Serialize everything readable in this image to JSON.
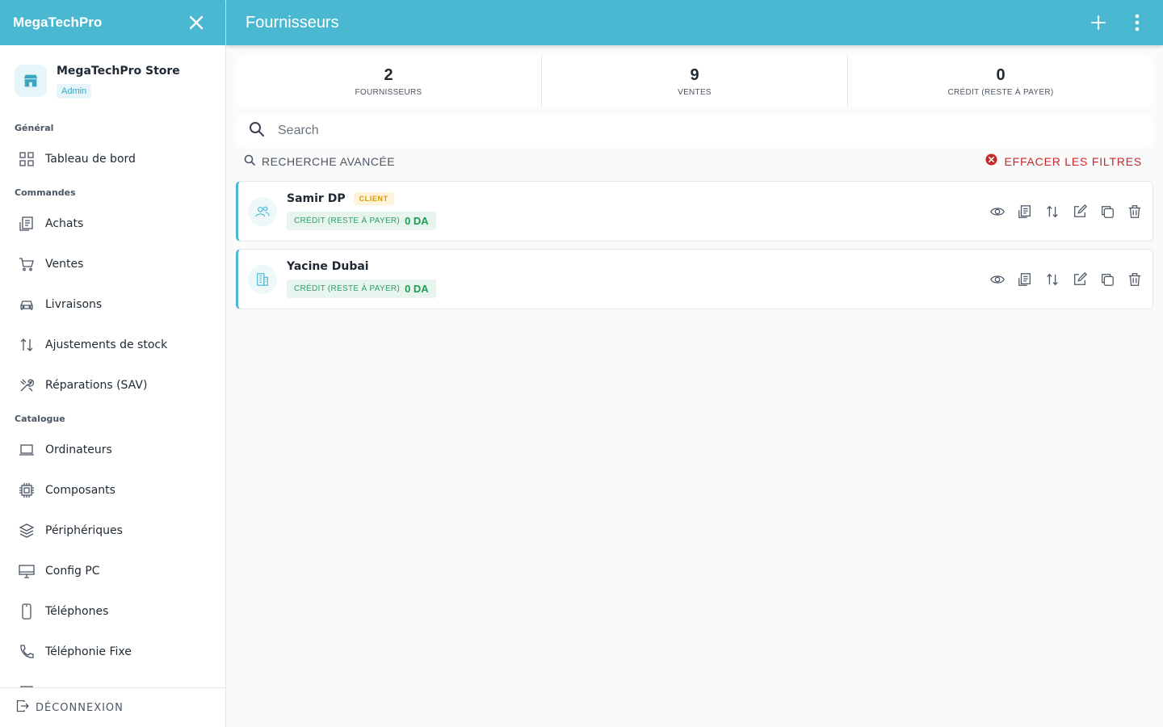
{
  "sidebar": {
    "brand": "MegaTechPro",
    "store": {
      "name": "MegaTechPro Store",
      "role": "Admin"
    },
    "sections": [
      {
        "title": "Général",
        "items": [
          {
            "label": "Tableau de bord",
            "icon": "dashboard-icon"
          }
        ]
      },
      {
        "title": "Commandes",
        "items": [
          {
            "label": "Achats",
            "icon": "purchase-icon"
          },
          {
            "label": "Ventes",
            "icon": "cart-icon"
          },
          {
            "label": "Livraisons",
            "icon": "car-icon"
          },
          {
            "label": "Ajustements de stock",
            "icon": "swap-icon"
          },
          {
            "label": "Réparations (SAV)",
            "icon": "tools-icon"
          }
        ]
      },
      {
        "title": "Catalogue",
        "items": [
          {
            "label": "Ordinateurs",
            "icon": "laptop-icon"
          },
          {
            "label": "Composants",
            "icon": "chip-icon"
          },
          {
            "label": "Périphériques",
            "icon": "layers-icon"
          },
          {
            "label": "Config PC",
            "icon": "monitor-icon"
          },
          {
            "label": "Téléphones",
            "icon": "phone-icon"
          },
          {
            "label": "Téléphonie Fixe",
            "icon": "landline-icon"
          }
        ]
      }
    ],
    "logout": "DÉCONNEXION"
  },
  "header": {
    "title": "Fournisseurs"
  },
  "stats": [
    {
      "value": "2",
      "label": "FOURNISSEURS"
    },
    {
      "value": "9",
      "label": "VENTES"
    },
    {
      "value": "0",
      "label": "CRÉDIT (RESTE À PAYER)"
    }
  ],
  "search": {
    "placeholder": "Search",
    "value": ""
  },
  "filters": {
    "advanced": "RECHERCHE AVANCÉE",
    "clear": "EFFACER LES FILTRES"
  },
  "suppliers": [
    {
      "name": "Samir DP",
      "badge": "CLIENT",
      "credit_label": "CRÉDIT (RESTE À PAYER)",
      "credit_value": "0 DA",
      "icon": "users-icon"
    },
    {
      "name": "Yacine Dubai",
      "badge": "",
      "credit_label": "CRÉDIT (RESTE À PAYER)",
      "credit_value": "0 DA",
      "icon": "building-icon"
    }
  ],
  "colors": {
    "primary": "#4ab8d0",
    "danger": "#c62828",
    "success": "#1f9d55",
    "badge": "#d69a06"
  }
}
